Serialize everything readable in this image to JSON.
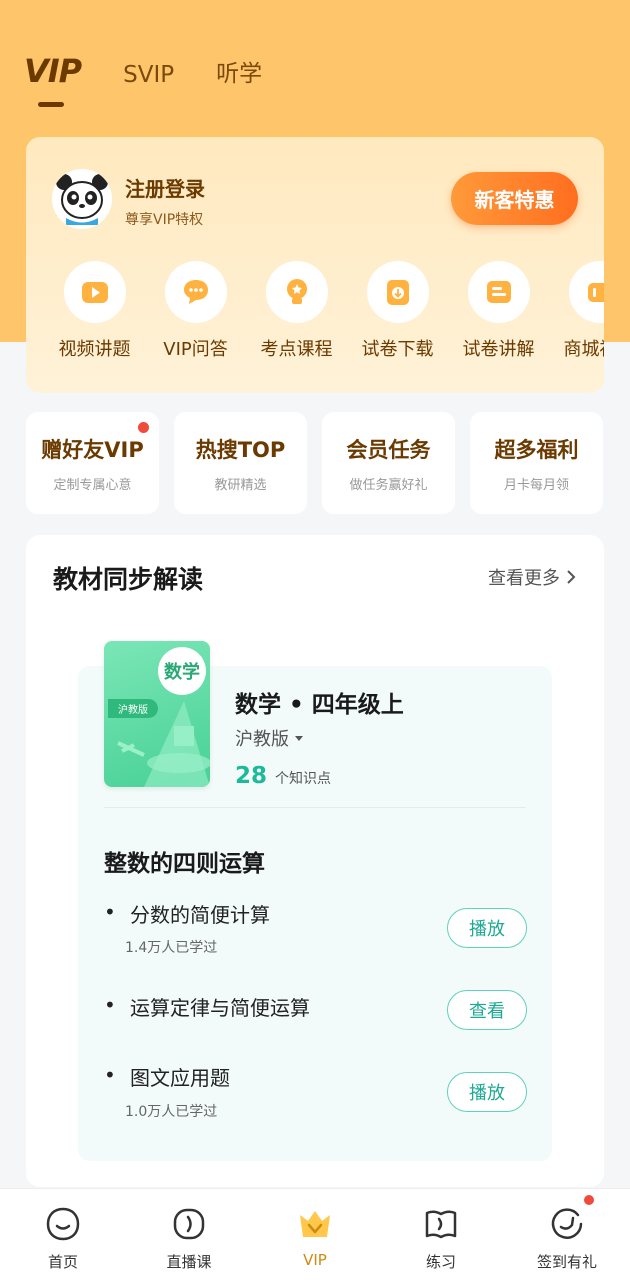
{
  "tabs": [
    {
      "label": "VIP",
      "active": true
    },
    {
      "label": "SVIP",
      "active": false
    },
    {
      "label": "听学",
      "active": false
    }
  ],
  "vip_card": {
    "login_title": "注册登录",
    "login_subtitle": "尊享VIP特权",
    "newbie_button": "新客特惠",
    "quick_items": [
      {
        "label": "视频讲题",
        "icon": "video-icon"
      },
      {
        "label": "VIP问答",
        "icon": "chat-icon"
      },
      {
        "label": "考点课程",
        "icon": "bulb-icon"
      },
      {
        "label": "试卷下载",
        "icon": "download-icon"
      },
      {
        "label": "试卷讲解",
        "icon": "paper-icon"
      },
      {
        "label": "商城福利",
        "icon": "wallet-icon"
      }
    ]
  },
  "features": [
    {
      "title": "赠好友VIP",
      "subtitle": "定制专属心意",
      "badge": true
    },
    {
      "title": "热搜TOP",
      "subtitle": "教研精选",
      "badge": false
    },
    {
      "title": "会员任务",
      "subtitle": "做任务赢好礼",
      "badge": false
    },
    {
      "title": "超多福利",
      "subtitle": "月卡每月领",
      "badge": false
    }
  ],
  "textbook": {
    "section_title": "教材同步解读",
    "more_label": "查看更多",
    "book": {
      "cover_subject": "数学",
      "cover_edition": "沪教版",
      "name": "数学 • 四年级上",
      "edition": "沪教版",
      "knowledge_count": "28",
      "knowledge_label": "个知识点"
    },
    "unit_title": "整数的四则运算",
    "lessons": [
      {
        "title": "分数的简便计算",
        "learned": "1.4万人已学过",
        "action": "播放"
      },
      {
        "title": "运算定律与简便运算",
        "learned": "",
        "action": "查看"
      },
      {
        "title": "图文应用题",
        "learned": "1.0万人已学过",
        "action": "播放"
      }
    ]
  },
  "bottom_nav": [
    {
      "label": "首页",
      "icon": "home-icon",
      "active": false
    },
    {
      "label": "直播课",
      "icon": "live-icon",
      "active": false
    },
    {
      "label": "VIP",
      "icon": "vip-crown-icon",
      "active": true
    },
    {
      "label": "练习",
      "icon": "practice-book-icon",
      "active": false
    },
    {
      "label": "签到有礼",
      "icon": "checkin-icon",
      "active": false,
      "badge": true
    }
  ],
  "colors": {
    "header_bg": "#ffc56a",
    "brand_brown": "#6b3a00",
    "accent_orange": "#ff7a25",
    "teal": "#1eb89a",
    "badge_red": "#f04a3a"
  }
}
